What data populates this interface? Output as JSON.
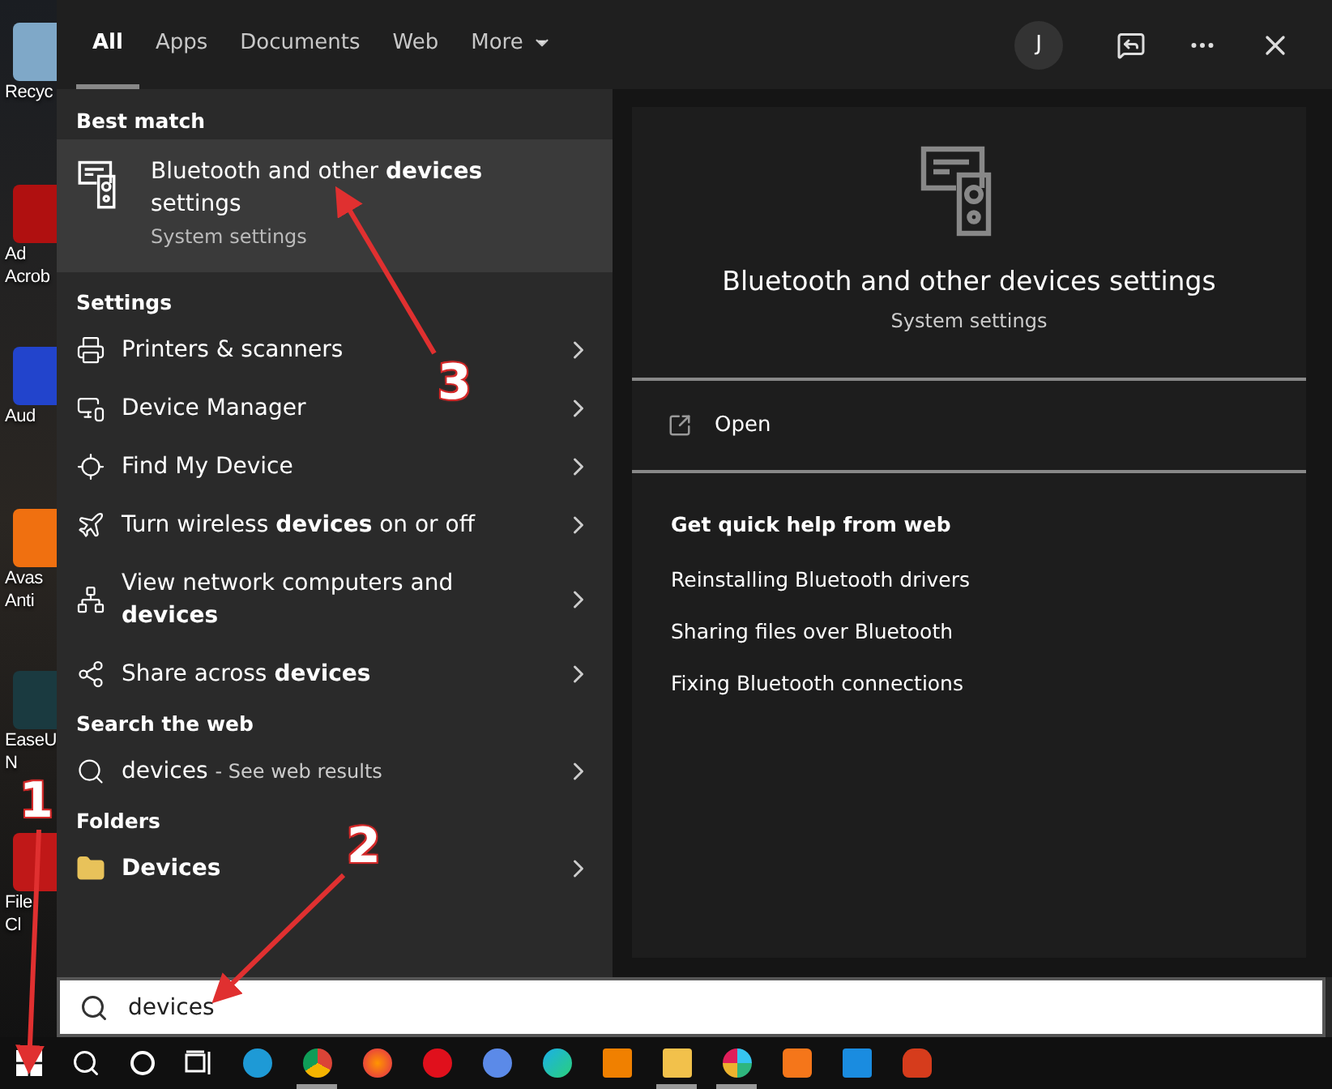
{
  "desktop_icons": [
    {
      "kind": "recycle",
      "lines": [
        "Recyc"
      ]
    },
    {
      "kind": "acrobat",
      "lines": [
        "Ad",
        "Acrob"
      ]
    },
    {
      "kind": "audio",
      "lines": [
        "Aud"
      ]
    },
    {
      "kind": "avast",
      "lines": [
        "Avas",
        "Anti"
      ]
    },
    {
      "kind": "easeus",
      "lines": [
        "EaseU",
        "N"
      ]
    },
    {
      "kind": "file",
      "lines": [
        "File",
        "Cl"
      ]
    }
  ],
  "tabs": [
    {
      "label": "All",
      "selected": true
    },
    {
      "label": "Apps",
      "selected": false
    },
    {
      "label": "Documents",
      "selected": false
    },
    {
      "label": "Web",
      "selected": false
    },
    {
      "label": "More",
      "selected": false,
      "dropdown": true
    }
  ],
  "account": {
    "initial": "J"
  },
  "best_match": {
    "heading": "Best match",
    "title": "Bluetooth and other **devices** settings",
    "subtitle": "System settings",
    "selected": true
  },
  "settings": {
    "heading": "Settings",
    "items": [
      {
        "kind": "printer",
        "label": "Printers & scanners"
      },
      {
        "kind": "device-manager",
        "label": "Device Manager"
      },
      {
        "kind": "find",
        "label": "Find My Device"
      },
      {
        "kind": "airplane",
        "label": "Turn wireless **devices** on or off"
      },
      {
        "kind": "network",
        "label": "View network computers and **devices**"
      },
      {
        "kind": "share",
        "label": "Share across **devices**"
      }
    ]
  },
  "web": {
    "heading": "Search the web",
    "query": "devices",
    "suffix": "- See web results"
  },
  "folders": {
    "heading": "Folders",
    "items": [
      {
        "label": "Devices"
      }
    ]
  },
  "preview": {
    "title": "Bluetooth and other devices settings",
    "subtitle": "System settings",
    "action": "Open",
    "help_heading": "Get quick help from web",
    "links": [
      "Reinstalling Bluetooth drivers",
      "Sharing files over Bluetooth",
      "Fixing Bluetooth connections"
    ]
  },
  "search": {
    "value": "devices"
  },
  "taskbar": {
    "apps": [
      {
        "kind": "skype",
        "running": false
      },
      {
        "kind": "chrome",
        "running": true
      },
      {
        "kind": "firefox",
        "running": false
      },
      {
        "kind": "opera",
        "running": false
      },
      {
        "kind": "chromium",
        "running": false
      },
      {
        "kind": "edge",
        "running": false
      },
      {
        "kind": "vlc",
        "running": false
      },
      {
        "kind": "explorer",
        "running": true
      },
      {
        "kind": "slack",
        "running": true
      },
      {
        "kind": "xampp",
        "running": false
      },
      {
        "kind": "store",
        "running": false
      },
      {
        "kind": "fire",
        "running": false
      }
    ]
  },
  "annotations": [
    {
      "label": "1"
    },
    {
      "label": "2"
    },
    {
      "label": "3"
    }
  ]
}
